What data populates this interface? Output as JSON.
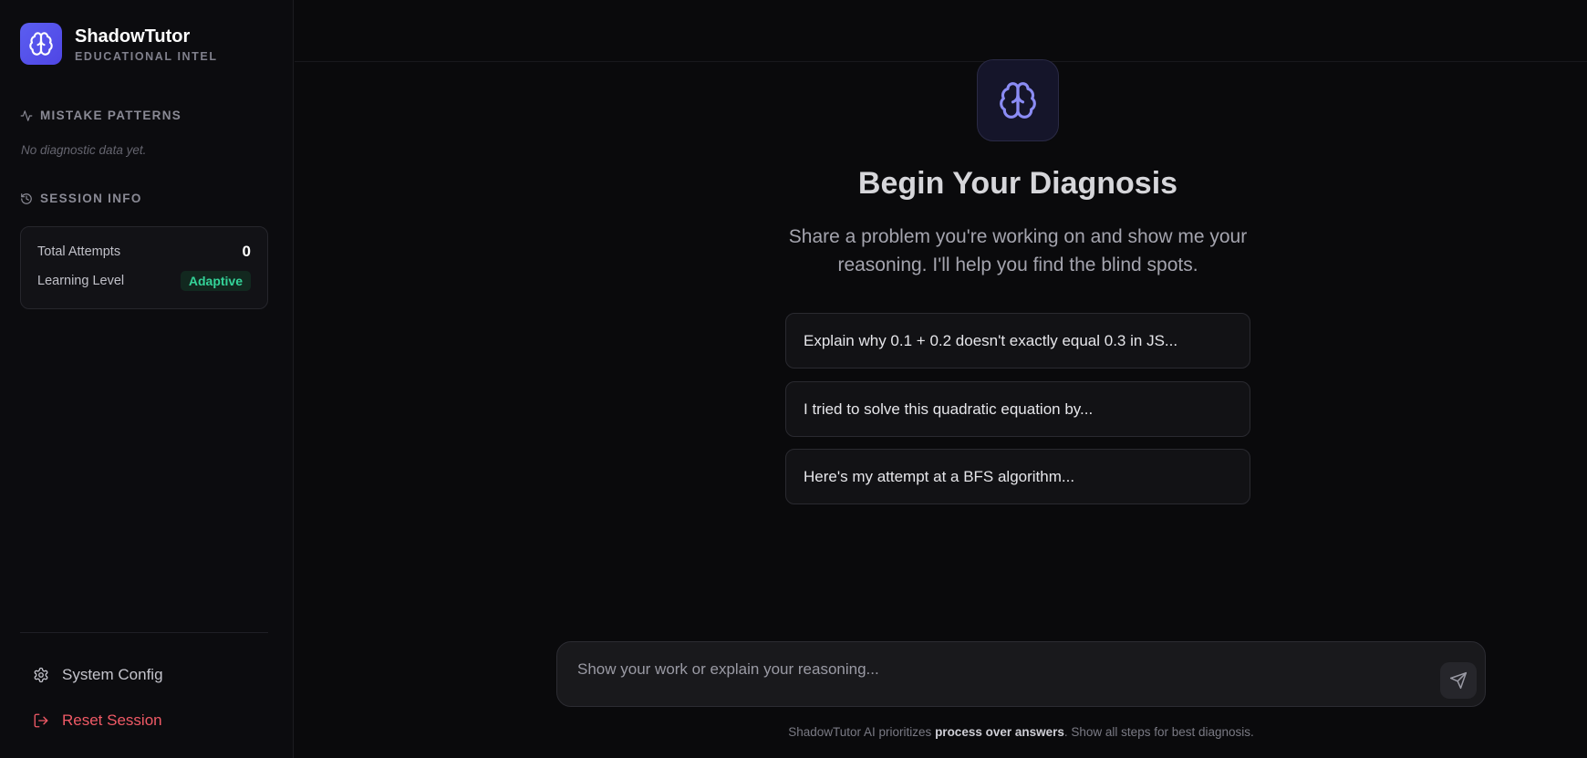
{
  "brand": {
    "name": "ShadowTutor",
    "subtitle": "EDUCATIONAL INTEL",
    "icon": "brain-icon",
    "accent": "#5b5ef0"
  },
  "sidebar": {
    "mistake_patterns": {
      "title": "MISTAKE PATTERNS",
      "icon": "activity-icon",
      "empty_text": "No diagnostic data yet."
    },
    "session_info": {
      "title": "SESSION INFO",
      "icon": "history-icon",
      "total_attempts_label": "Total Attempts",
      "total_attempts_value": "0",
      "learning_level_label": "Learning Level",
      "learning_level_value": "Adaptive",
      "learning_level_color": "#34d399"
    },
    "system_config": {
      "label": "System Config",
      "icon": "gear-icon"
    },
    "reset_session": {
      "label": "Reset Session",
      "icon": "logout-icon",
      "color": "#f05a66"
    }
  },
  "main": {
    "hero_icon": "brain-icon",
    "title": "Begin Your Diagnosis",
    "subtitle": "Share a problem you're working on and show me your reasoning. I'll help you find the blind spots.",
    "suggestions": [
      "Explain why 0.1 + 0.2 doesn't exactly equal 0.3 in JS...",
      "I tried to solve this quadratic equation by...",
      "Here's my attempt at a BFS algorithm..."
    ],
    "composer": {
      "placeholder": "Show your work or explain your reasoning...",
      "value": "",
      "send_icon": "send-icon"
    },
    "footer": {
      "prefix": "ShadowTutor AI prioritizes ",
      "emphasis": "process over answers",
      "suffix": ". Show all steps for best diagnosis."
    }
  }
}
